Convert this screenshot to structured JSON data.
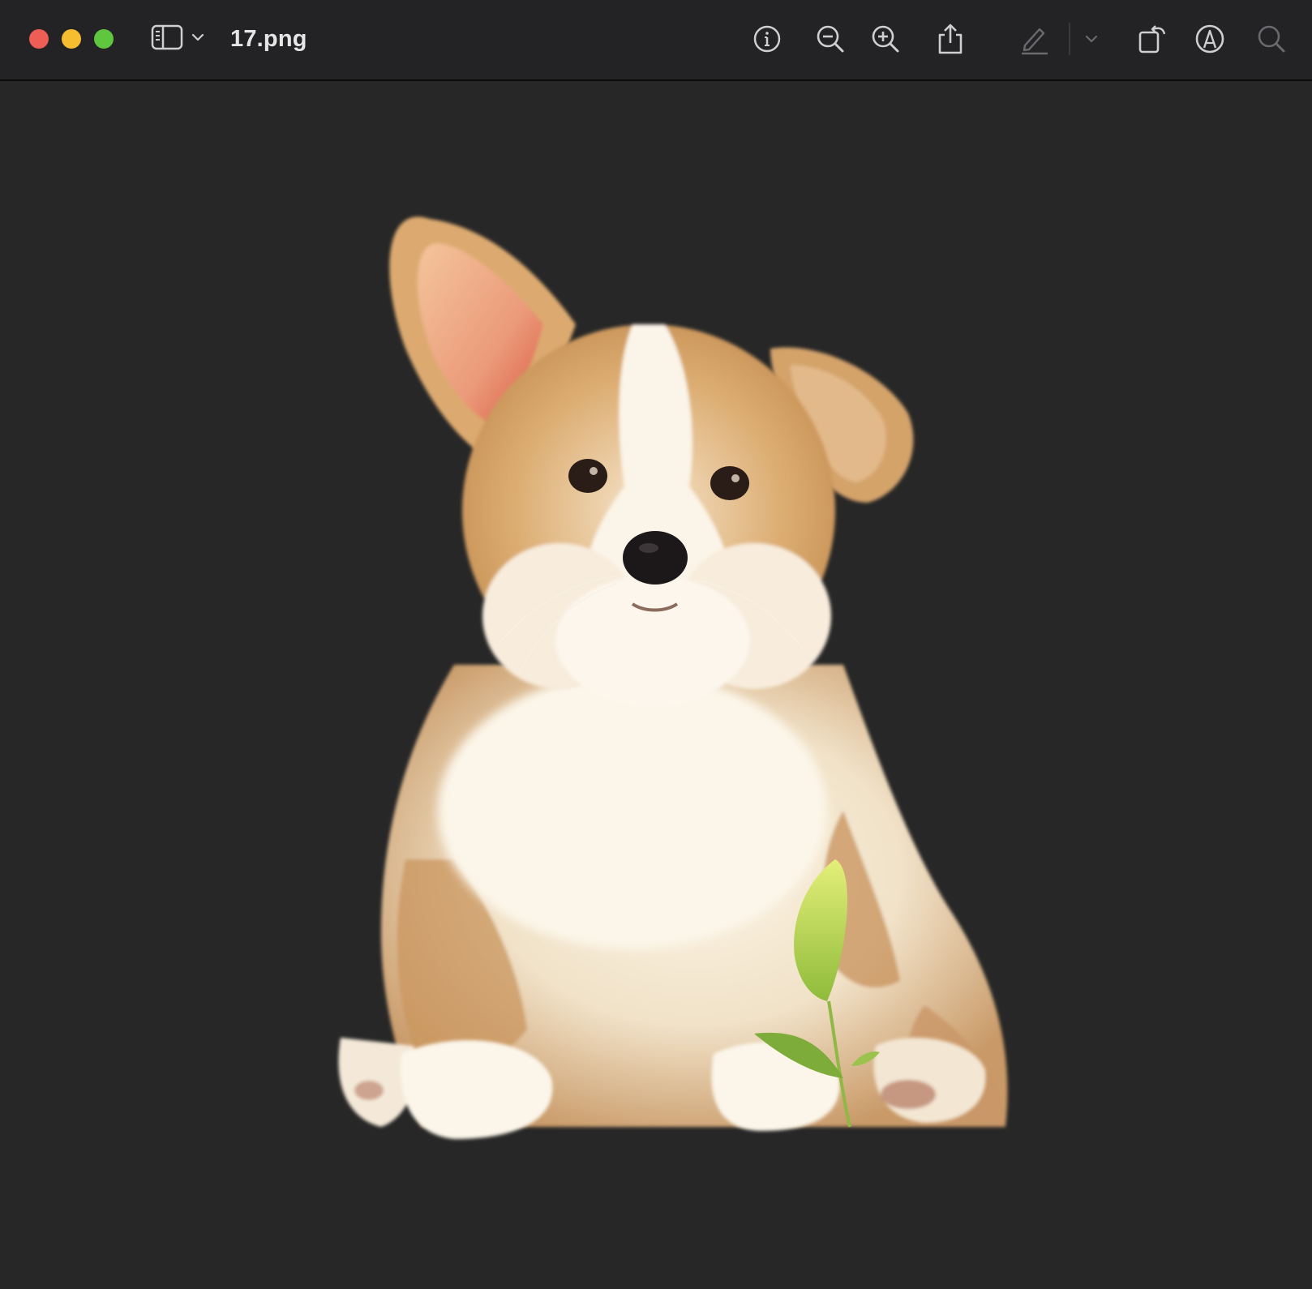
{
  "window": {
    "title": "17.png",
    "traffic_lights": {
      "close_color": "#ee5e57",
      "minimize_color": "#f5bd2f",
      "zoom_color": "#5fc63f"
    }
  },
  "toolbar": {
    "icons": [
      "sidebar-icon",
      "chevron-down-icon",
      "info-icon",
      "zoom-out-icon",
      "zoom-in-icon",
      "share-icon",
      "highlight-pen-icon",
      "chevron-down-icon",
      "rotate-icon",
      "markup-icon",
      "search-icon"
    ],
    "icon_color": "#cfcfd1",
    "disabled_icon_color": "#6a6a6e"
  },
  "canvas": {
    "background": "#272727",
    "image": {
      "subject": "corgi-puppy",
      "description_icon": "photo"
    }
  }
}
